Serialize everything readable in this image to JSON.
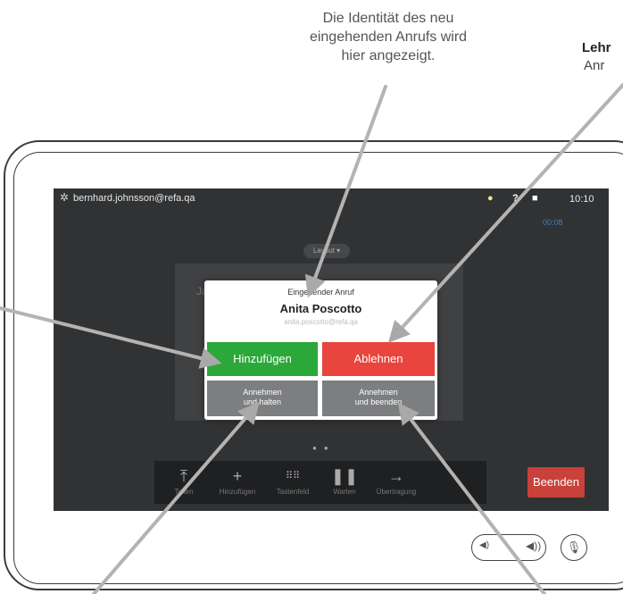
{
  "callouts": {
    "top_line1": "Die Identität des neu",
    "top_line2": "eingehenden Anrufs wird",
    "top_line3": "hier angezeigt.",
    "right_bold": "Lehr",
    "right_text": "Anr"
  },
  "statusbar": {
    "user": "bernhard.johnsson@refa.qa",
    "time": "10:10",
    "timer": "00:08",
    "icons": [
      "settings-icon",
      "lightbulb-icon",
      "help-icon",
      "self-view-icon"
    ]
  },
  "layout_button": "Layout",
  "background_call": {
    "name": "Ja"
  },
  "toolbar": {
    "items": [
      {
        "icon": "share-icon",
        "label": "Teilen"
      },
      {
        "icon": "plus-icon",
        "label": "Hinzufügen"
      },
      {
        "icon": "keypad-icon",
        "label": "Tastenfeld"
      },
      {
        "icon": "pause-icon",
        "label": "Warten"
      },
      {
        "icon": "transfer-icon",
        "label": "Übertragung"
      }
    ],
    "end": "Beenden"
  },
  "dialog": {
    "title": "Eingehender Anruf",
    "caller": "Anita Poscotto",
    "address": "anita.poscotto@refa.qa",
    "add": "Hinzufügen",
    "decline": "Ablehnen",
    "hold_line1": "Annehmen",
    "hold_line2": "und halten",
    "endans_line1": "Annehmen",
    "endans_line2": "und beenden"
  },
  "colors": {
    "accept": "#2ca73a",
    "decline": "#e9443d",
    "end": "#c8413a",
    "neutral": "#7d7e80",
    "screen": "#313234"
  }
}
